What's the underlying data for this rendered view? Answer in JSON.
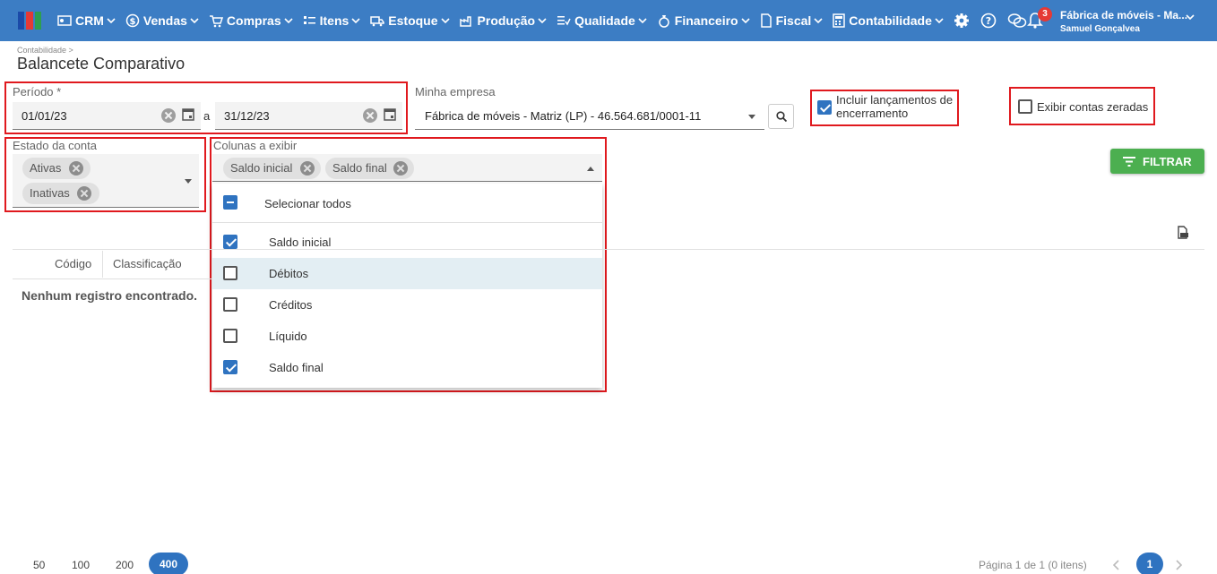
{
  "nav": {
    "items": [
      "CRM",
      "Vendas",
      "Compras",
      "Itens",
      "Estoque",
      "Produção",
      "Qualidade",
      "Financeiro",
      "Fiscal",
      "Contabilidade"
    ],
    "notifications": "3",
    "company": "Fábrica de móveis - Ma...",
    "user": "Samuel Gonçalvea"
  },
  "breadcrumb": "Contabilidade >",
  "title": "Balancete Comparativo",
  "periodo": {
    "label": "Período *",
    "start": "01/01/23",
    "sep": "a",
    "end": "31/12/23"
  },
  "empresa": {
    "label": "Minha empresa",
    "value": "Fábrica de móveis - Matriz (LP) - 46.564.681/0001-11"
  },
  "incluir": {
    "line1": "Incluir lançamentos de",
    "line2": "encerramento",
    "checked": true
  },
  "exibir_zeradas": {
    "label": "Exibir contas zeradas",
    "checked": false
  },
  "estado": {
    "label": "Estado da conta",
    "chips": [
      "Ativas",
      "Inativas"
    ]
  },
  "colunas": {
    "label": "Colunas a exibir",
    "chips": [
      "Saldo inicial",
      "Saldo final"
    ],
    "select_all": "Selecionar todos",
    "options": [
      {
        "label": "Saldo inicial",
        "checked": true
      },
      {
        "label": "Débitos",
        "checked": false
      },
      {
        "label": "Créditos",
        "checked": false
      },
      {
        "label": "Líquido",
        "checked": false
      },
      {
        "label": "Saldo final",
        "checked": true
      }
    ]
  },
  "filter_label": "FILTRAR",
  "table": {
    "headers": [
      "Código",
      "Classificação"
    ],
    "empty": "Nenhum registro encontrado."
  },
  "pagination": {
    "sizes": [
      "50",
      "100",
      "200",
      "400"
    ],
    "selected": "400",
    "info": "Página 1 de 1 (0 itens)",
    "current": "1"
  },
  "colors": {
    "nav": "#3c7dc4",
    "accent": "#2f73c0",
    "filter": "#4caf50",
    "highlight": "#e0191e"
  }
}
